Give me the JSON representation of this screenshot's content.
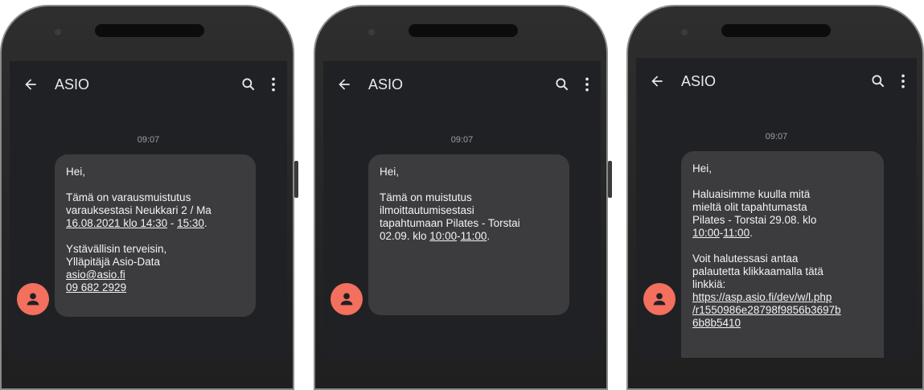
{
  "appbar": {
    "title": "ASIO"
  },
  "screens": [
    {
      "time": "09:07",
      "greeting": "Hei,",
      "p1": {
        "line1": "Tämä on varausmuistutus",
        "line2": "varauksestasi Neukkari 2 / Ma",
        "date_link": "16.08.2021 klo 14:30",
        "sep": " - ",
        "end_link": "15:30",
        "end": "."
      },
      "p2": {
        "line1": "Ystävällisin terveisin,",
        "line2": "Ylläpitäjä Asio-Data",
        "email": "asio@asio.fi",
        "phone": "09 682 2929"
      }
    },
    {
      "time": "09:07",
      "greeting": "Hei,",
      "p1": {
        "line1": "Tämä on muistutus",
        "line2": "ilmoittautumisestasi",
        "line3": "tapahtumaan Pilates - Torstai",
        "line4_pre": "02.09. klo ",
        "start_link": "10:00",
        "sep": "-",
        "end_link": "11:00",
        "end": "."
      }
    },
    {
      "time": "09:07",
      "greeting": "Hei,",
      "p1": {
        "line1": "Haluaisimme kuulla mitä",
        "line2": "mieltä olit tapahtumasta",
        "line3": "Pilates - Torstai 29.08. klo",
        "start_link": "10:00",
        "sep": "-",
        "end_link": "11:00",
        "end": "."
      },
      "p2": {
        "line1": "Voit halutessasi antaa",
        "line2": "palautetta klikkaamalla tätä",
        "line3": "linkkiä:",
        "link1": "https://asp.asio.fi/dev/w/l.php",
        "link2": "/r1550986e28798f9856b3697b",
        "link3": "6b8b5410"
      }
    }
  ]
}
